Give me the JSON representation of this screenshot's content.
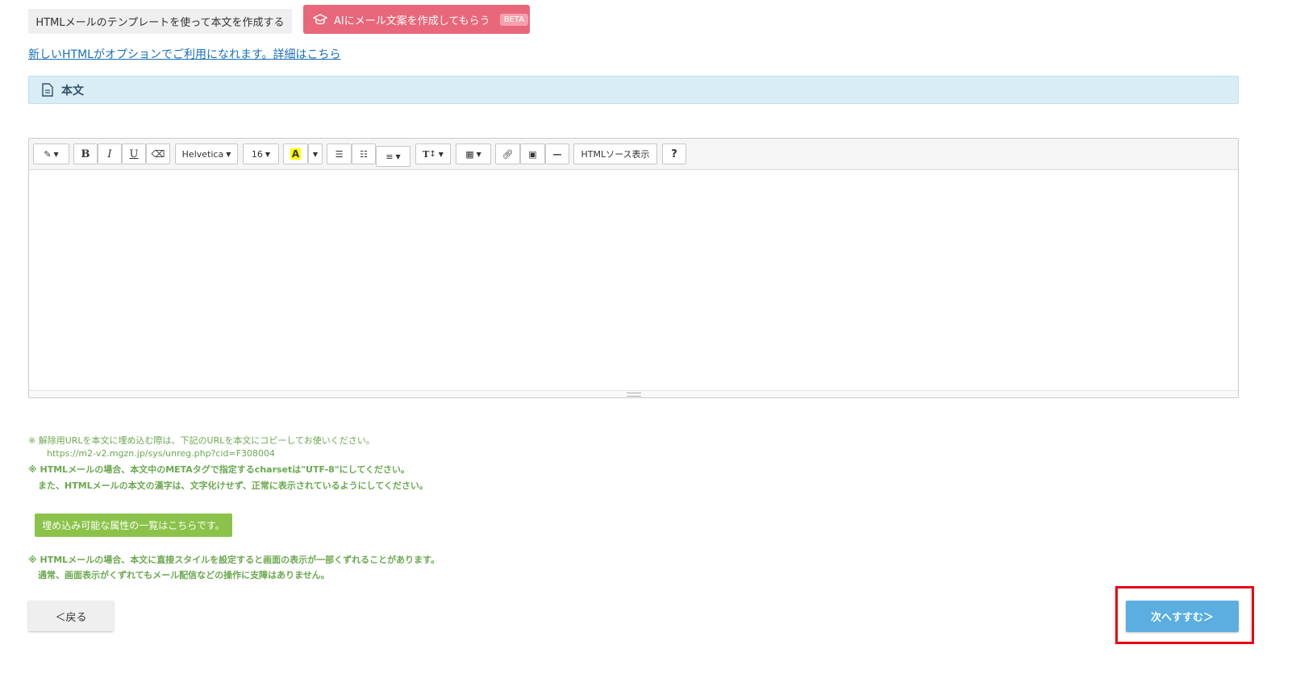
{
  "top": {
    "template_button": "HTMLメールのテンプレートを使って本文を作成する",
    "ai_button": "AIにメール文案を作成してもらう",
    "ai_badge": "BETA",
    "html_option_link": "新しいHTMLがオプションでご利用になれます。詳細はこちら"
  },
  "section": {
    "title": "本文"
  },
  "toolbar": {
    "font_family": "Helvetica",
    "font_size": "16",
    "source_button": "HTMLソース表示",
    "help_button": "?",
    "bold": "B",
    "italic": "I",
    "underline": "U",
    "color_label": "A",
    "text_size_label": "T"
  },
  "notes": {
    "unsubscribe": "※ 解除用URLを本文に埋め込む際は、下記のURLを本文にコピーしてお使いください。",
    "unsubscribe_url": "https://m2-v2.mgzn.jp/sys/unreg.php?cid=F308004",
    "charset": "※ HTMLメールの場合、本文中のMETAタグで指定するcharsetは\"UTF-8\"にしてください。",
    "kanji": "また、HTMLメールの本文の漢字は、文字化けせず、正常に表示されているようにしてください。",
    "attr_button": "埋め込み可能な属性の一覧はこちらです。",
    "style_warning": "※ HTMLメールの場合、本文に直接スタイルを設定すると画面の表示が一部くずれることがあります。",
    "style_ok": "通常、画面表示がくずれてもメール配信などの操作に支障はありません。"
  },
  "nav": {
    "back": "＜戻る",
    "next": "次へすすむ＞"
  },
  "colors": {
    "ai_button": "#e8677a",
    "note_text": "#6aa84f",
    "next_button": "#5aaee0",
    "highlight": "#e60012"
  }
}
